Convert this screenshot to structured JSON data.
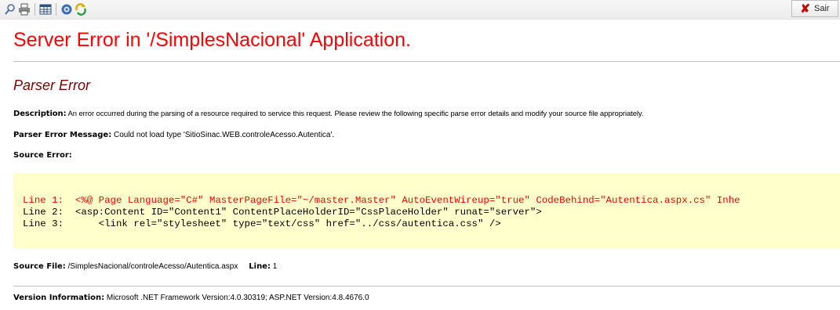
{
  "toolbar": {
    "icons": [
      "search-icon",
      "printer-icon",
      "grid-icon",
      "gear-icon",
      "refresh-icon"
    ],
    "exit_label": "Sair"
  },
  "error": {
    "title": "Server Error in '/SimplesNacional' Application.",
    "subtitle": "Parser Error",
    "description_label": "Description:",
    "description_text": "An error occurred during the parsing of a resource required to service this request. Please review the following specific parse error details and modify your source file appropriately.",
    "parser_message_label": "Parser Error Message:",
    "parser_message_text": "Could not load type 'SitioSinac.WEB.controleAcesso.Autentica'.",
    "source_error_label": "Source Error:",
    "code_lines": [
      "Line 1:  <%@ Page Language=\"C#\" MasterPageFile=\"~/master.Master\" AutoEventWireup=\"true\" CodeBehind=\"Autentica.aspx.cs\" Inhe",
      "Line 2:  <asp:Content ID=\"Content1\" ContentPlaceHolderID=\"CssPlaceHolder\" runat=\"server\">",
      "Line 3:      <link rel=\"stylesheet\" type=\"text/css\" href=\"../css/autentica.css\" />"
    ],
    "source_file_label": "Source File:",
    "source_file_path": "/SimplesNacional/controleAcesso/Autentica.aspx",
    "line_label": "Line:",
    "line_value": "1",
    "version_label": "Version Information:",
    "version_text": "Microsoft .NET Framework Version:4.0.30319; ASP.NET Version:4.8.4676.0"
  },
  "colors": {
    "title": "#ff0000",
    "subtitle": "#800000",
    "code_background": "#ffffcc",
    "error_line": "#ff0000"
  }
}
